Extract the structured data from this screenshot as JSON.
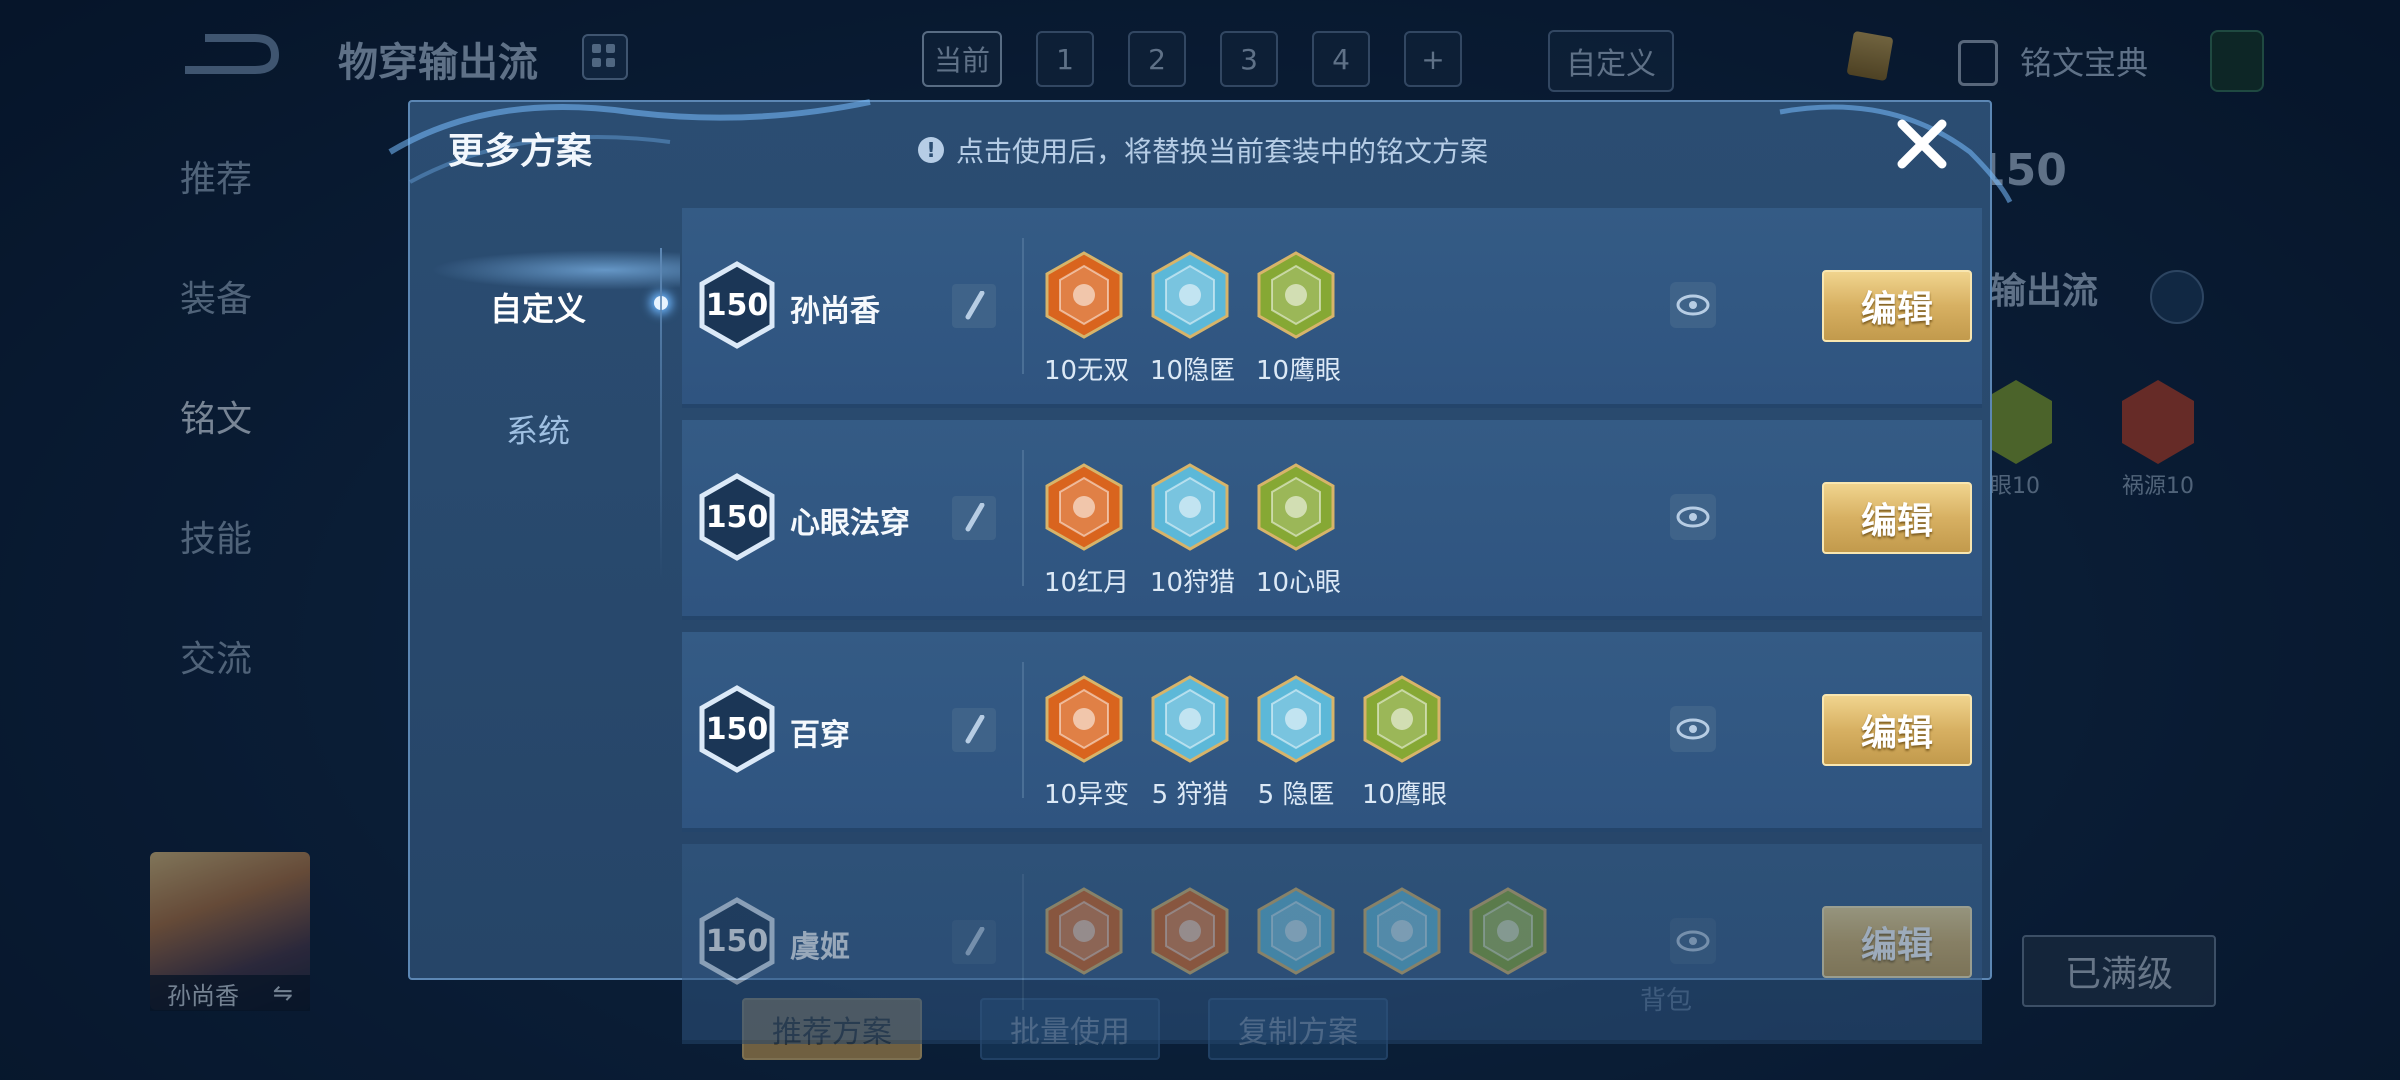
{
  "background": {
    "page_title": "物穿输出流",
    "tabs": [
      {
        "label": "当前"
      },
      {
        "label": "1"
      },
      {
        "label": "2"
      },
      {
        "label": "3"
      },
      {
        "label": "4"
      },
      {
        "label": "+"
      }
    ],
    "custom_tab": "自定义",
    "codex_label": "铭文宝典",
    "side_nav": [
      {
        "label": "推荐"
      },
      {
        "label": "装备"
      },
      {
        "label": "铭文"
      },
      {
        "label": "技能"
      },
      {
        "label": "交流"
      }
    ],
    "right_level": "150",
    "right_title": "输出流",
    "right_runes": [
      {
        "label": "眼10"
      },
      {
        "label": "祸源10"
      }
    ],
    "hero_name": "孙尚香",
    "bottom_buttons": [
      {
        "label": "推荐方案"
      },
      {
        "label": "批量使用"
      },
      {
        "label": "复制方案"
      }
    ],
    "bag_label": "背包",
    "maxed_label": "已满级"
  },
  "modal": {
    "title": "更多方案",
    "notice": "点击使用后，将替换当前套装中的铭文方案",
    "info_icon": "!",
    "side_tabs": [
      {
        "label": "自定义"
      },
      {
        "label": "系统"
      }
    ],
    "edit_label": "编辑",
    "plans": [
      {
        "level": "150",
        "name": "孙尚香",
        "runes": [
          {
            "label": "10无双",
            "color": "#d9641e"
          },
          {
            "label": "10隐匿",
            "color": "#5cb8d8"
          },
          {
            "label": "10鹰眼",
            "color": "#86a834"
          }
        ]
      },
      {
        "level": "150",
        "name": "心眼法穿",
        "runes": [
          {
            "label": "10红月",
            "color": "#d9641e"
          },
          {
            "label": "10狩猎",
            "color": "#5cb8d8"
          },
          {
            "label": "10心眼",
            "color": "#86a834"
          }
        ]
      },
      {
        "level": "150",
        "name": "百穿",
        "runes": [
          {
            "label": "10异变",
            "color": "#d9641e"
          },
          {
            "label": "5 狩猎",
            "color": "#5cb8d8"
          },
          {
            "label": "5 隐匿",
            "color": "#5cb8d8"
          },
          {
            "label": "10鹰眼",
            "color": "#86a834"
          }
        ]
      },
      {
        "level": "150",
        "name": "虞姬",
        "runes": [
          {
            "label": "",
            "color": "#d9641e"
          },
          {
            "label": "",
            "color": "#d9641e"
          },
          {
            "label": "",
            "color": "#5cb8d8"
          },
          {
            "label": "",
            "color": "#5cb8d8"
          },
          {
            "label": "",
            "color": "#86a834"
          }
        ]
      }
    ]
  }
}
